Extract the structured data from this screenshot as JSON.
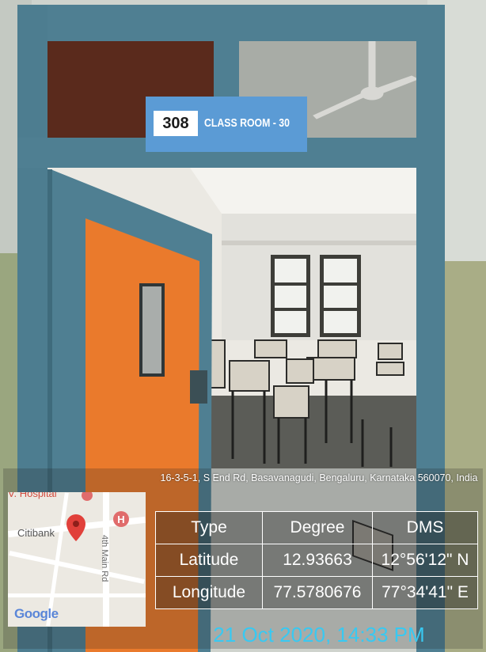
{
  "sign": {
    "room_number": "308",
    "room_label": "CLASS ROOM - 30"
  },
  "geotag": {
    "address": "16-3-5-1, S End Rd, Basavanagudi, Bengaluru, Karnataka 560070, India",
    "table": {
      "headers": [
        "Type",
        "Degree",
        "DMS"
      ],
      "rows": [
        [
          "Latitude",
          "12.93663",
          "12°56'12\" N"
        ],
        [
          "Longitude",
          "77.5780676",
          "77°34'41\" E"
        ]
      ]
    },
    "datetime": "21 Oct 2020, 14:33 PM"
  },
  "map": {
    "poi_top": "V. Hospital",
    "poi_bank": "Citibank",
    "street": "4th Main Rd",
    "logo": "Google",
    "icons": [
      "location-pin-icon",
      "hospital-marker-icon"
    ]
  },
  "colors": {
    "door_frame": "#4f7f92",
    "door_panel": "#ea7a2c",
    "sign_blue": "#5b9bd5",
    "timestamp_cyan": "#38c9f2",
    "pin_red": "#e1403a"
  }
}
